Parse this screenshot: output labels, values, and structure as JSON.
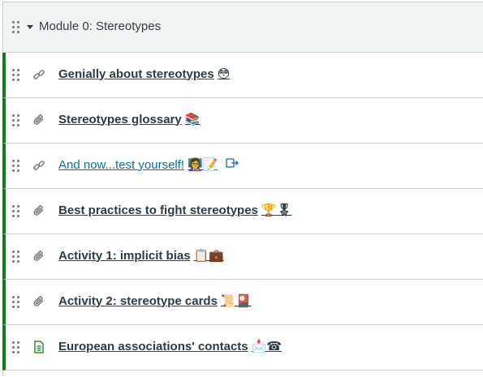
{
  "module": {
    "title": "Module 0: Stereotypes"
  },
  "items": [
    {
      "type": "link",
      "title": "Genially about stereotypes",
      "emojis": "😳"
    },
    {
      "type": "attachment",
      "title": "Stereotypes glossary",
      "emojis": "📚"
    },
    {
      "type": "link",
      "title": "And now...test yourself!",
      "emojis": "👩‍🏫📝"
    },
    {
      "type": "attachment",
      "title": "Best practices to fight stereotypes",
      "emojis": "🏆🎖"
    },
    {
      "type": "attachment",
      "title": "Activity 1: implicit bias",
      "emojis": "📋💼"
    },
    {
      "type": "attachment",
      "title": "Activity 2: stereotype cards",
      "emojis": "📜🎴"
    },
    {
      "type": "page",
      "title": "European associations' contacts",
      "emojis": "📩☎"
    }
  ],
  "colors": {
    "accent": "#127a1b",
    "link": "#0770a3",
    "text": "#2d3b45"
  }
}
